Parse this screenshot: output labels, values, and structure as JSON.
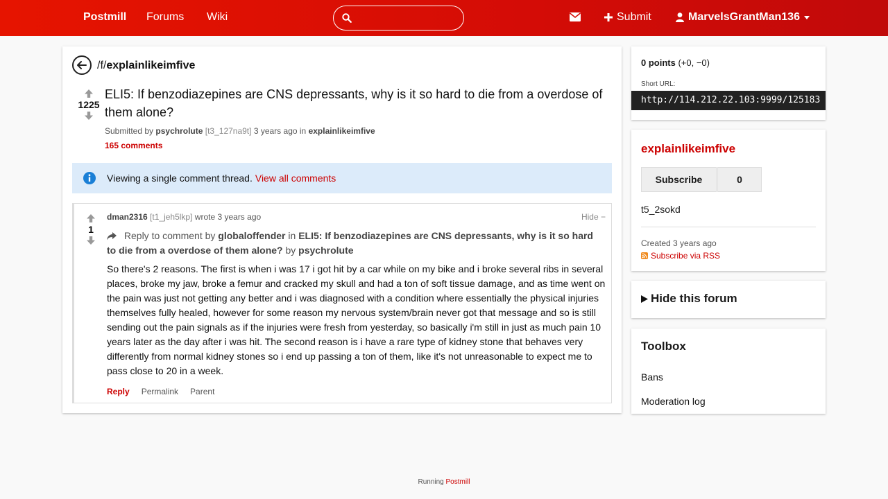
{
  "nav": {
    "brand": "Postmill",
    "links": [
      "Forums",
      "Wiki"
    ],
    "search_placeholder": "",
    "submit_label": "Submit",
    "username": "MarvelsGrantMan136"
  },
  "post": {
    "forum_prefix": "/f/",
    "forum": "explainlikeimfive",
    "score": "1225",
    "title": "ELI5: If benzodiazepines are CNS depressants, why is it so hard to die from a overdose of them alone?",
    "submitted_by": "Submitted by",
    "author": "psychrolute",
    "author_id": "[t3_127na9t]",
    "time": "3 years ago",
    "in_label": "in",
    "forum_link": "explainlikeimfive",
    "comments": "165 comments"
  },
  "notice": {
    "text": "Viewing a single comment thread.",
    "link": "View all comments"
  },
  "comment": {
    "score": "1",
    "author": "dman2316",
    "author_id": "[t1_jeh5lkp]",
    "wrote": "wrote 3 years ago",
    "hide": "Hide −",
    "reply_to_prefix": "Reply to comment by",
    "reply_to_user": "globaloffender",
    "in_label": "in",
    "reply_to_title": "ELI5: If benzodiazepines are CNS depressants, why is it so hard to die from a overdose of them alone?",
    "by_label": "by",
    "reply_to_author": "psychrolute",
    "body": "So there's 2 reasons. The first is when i was 17 i got hit by a car while on my bike and i broke several ribs in several places, broke my jaw, broke a femur and cracked my skull and had a ton of soft tissue damage, and as time went on the pain was just not getting any better and i was diagnosed with a condition where essentially the physical injuries themselves fully healed, however for some reason my nervous system/brain never got that message and so is still sending out the pain signals as if the injuries were fresh from yesterday, so basically i'm still in just as much pain 10 years later as the day after i was hit. The second reason is i have a rare type of kidney stone that behaves very differently from normal kidney stones so i end up passing a ton of them, like it's not unreasonable to expect me to pass close to 20 in a week.",
    "actions": [
      "Reply",
      "Permalink",
      "Parent"
    ]
  },
  "sidebar": {
    "points": "0 points",
    "points_detail": "(+0, −0)",
    "short_url_label": "Short URL:",
    "short_url": "http://114.212.22.103:9999/125183",
    "forum_name": "explainlikeimfive",
    "subscribe": "Subscribe",
    "subscribers": "0",
    "forum_id": "t5_2sokd",
    "created": "Created 3 years ago",
    "rss": "Subscribe via RSS",
    "hide_forum": "Hide this forum",
    "toolbox_title": "Toolbox",
    "toolbox_links": [
      "Bans",
      "Moderation log"
    ]
  },
  "footer": {
    "running": "Running",
    "link": "Postmill"
  },
  "colors": {
    "accent": "#cc0000",
    "nav_start": "#e61400",
    "nav_end": "#c10a0a",
    "notice_bg": "#dcebfa",
    "info_icon": "#1a7fd6"
  },
  "icons": [
    "search-icon",
    "envelope-icon",
    "plus-icon",
    "user-icon",
    "caret-down-icon",
    "back-arrow-icon",
    "upvote-icon",
    "downvote-icon",
    "info-icon",
    "reply-arrow-icon",
    "rss-icon",
    "triangle-right-icon"
  ]
}
